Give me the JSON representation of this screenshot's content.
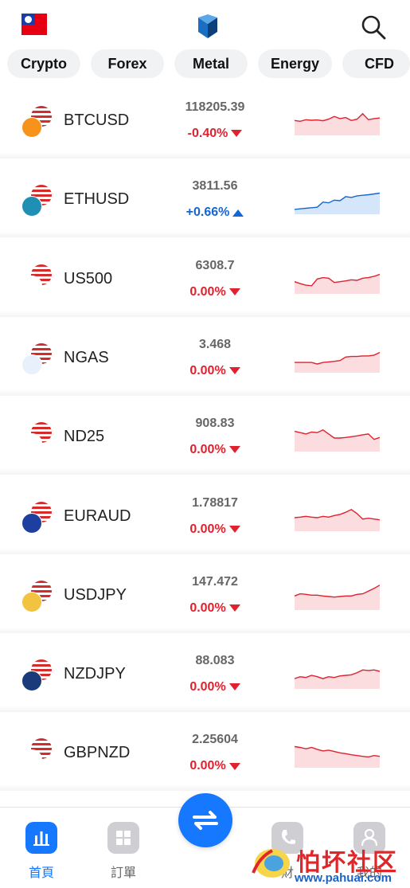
{
  "header": {
    "flag_icon": "taiwan-flag-icon",
    "logo_icon": "app-logo-icon",
    "search_icon": "search-icon"
  },
  "tabs": [
    {
      "label": "Crypto"
    },
    {
      "label": "Forex"
    },
    {
      "label": "Metal"
    },
    {
      "label": "Energy"
    },
    {
      "label": "CFD"
    }
  ],
  "colors": {
    "down": "#e0212e",
    "up": "#1466d8",
    "accent": "#1677ff"
  },
  "quotes": [
    {
      "symbol": "BTCUSD",
      "price": "118205.39",
      "change": "-0.40%",
      "direction": "down",
      "icon": "btc-usd-icon",
      "spark": [
        0.45,
        0.48,
        0.42,
        0.44,
        0.43,
        0.46,
        0.4,
        0.3,
        0.38,
        0.34,
        0.45,
        0.4,
        0.2,
        0.42,
        0.38,
        0.36
      ]
    },
    {
      "symbol": "ETHUSD",
      "price": "3811.56",
      "change": "+0.66%",
      "direction": "up",
      "icon": "eth-usd-icon",
      "spark": [
        0.82,
        0.8,
        0.78,
        0.76,
        0.74,
        0.55,
        0.58,
        0.48,
        0.5,
        0.35,
        0.38,
        0.32,
        0.3,
        0.28,
        0.25,
        0.22
      ]
    },
    {
      "symbol": "US500",
      "price": "6308.7",
      "change": "0.00%",
      "direction": "down",
      "icon": "us500-icon",
      "spark": [
        0.55,
        0.62,
        0.68,
        0.7,
        0.45,
        0.4,
        0.42,
        0.58,
        0.55,
        0.52,
        0.48,
        0.5,
        0.42,
        0.4,
        0.35,
        0.28
      ]
    },
    {
      "symbol": "NGAS",
      "price": "3.468",
      "change": "0.00%",
      "direction": "down",
      "icon": "natural-gas-icon",
      "spark": [
        0.62,
        0.62,
        0.62,
        0.62,
        0.68,
        0.62,
        0.6,
        0.58,
        0.55,
        0.42,
        0.4,
        0.4,
        0.38,
        0.38,
        0.35,
        0.25
      ]
    },
    {
      "symbol": "ND25",
      "price": "908.83",
      "change": "0.00%",
      "direction": "down",
      "icon": "nd25-icon",
      "spark": [
        0.25,
        0.3,
        0.35,
        0.28,
        0.3,
        0.2,
        0.35,
        0.5,
        0.5,
        0.48,
        0.45,
        0.42,
        0.38,
        0.35,
        0.55,
        0.48
      ]
    },
    {
      "symbol": "EURAUD",
      "price": "1.78817",
      "change": "0.00%",
      "direction": "down",
      "icon": "eur-aud-icon",
      "spark": [
        0.5,
        0.48,
        0.45,
        0.48,
        0.5,
        0.45,
        0.48,
        0.42,
        0.38,
        0.3,
        0.2,
        0.35,
        0.55,
        0.52,
        0.55,
        0.58
      ]
    },
    {
      "symbol": "USDJPY",
      "price": "147.472",
      "change": "0.00%",
      "direction": "down",
      "icon": "usd-jpy-icon",
      "spark": [
        0.48,
        0.4,
        0.42,
        0.45,
        0.45,
        0.48,
        0.5,
        0.52,
        0.5,
        0.48,
        0.48,
        0.42,
        0.4,
        0.3,
        0.2,
        0.08
      ]
    },
    {
      "symbol": "NZDJPY",
      "price": "88.083",
      "change": "0.00%",
      "direction": "down",
      "icon": "nzd-jpy-icon",
      "spark": [
        0.62,
        0.55,
        0.58,
        0.5,
        0.55,
        0.62,
        0.55,
        0.58,
        0.52,
        0.5,
        0.48,
        0.4,
        0.3,
        0.32,
        0.3,
        0.35
      ]
    },
    {
      "symbol": "GBPNZD",
      "price": "2.25604",
      "change": "0.00%",
      "direction": "down",
      "icon": "gbp-nzd-icon",
      "spark": [
        0.22,
        0.25,
        0.3,
        0.25,
        0.32,
        0.38,
        0.35,
        0.4,
        0.45,
        0.48,
        0.52,
        0.55,
        0.58,
        0.6,
        0.55,
        0.58
      ]
    }
  ],
  "bottom_nav": [
    {
      "label": "首頁",
      "icon": "chart-bar-icon",
      "active": true
    },
    {
      "label": "訂單",
      "icon": "grid-icon",
      "active": false
    },
    {
      "label": "",
      "icon": "swap-arrows-icon",
      "active": false
    },
    {
      "label": "財",
      "icon": "phone-icon",
      "active": false
    },
    {
      "label": "我的",
      "icon": "user-icon",
      "active": false
    }
  ],
  "watermark": {
    "text": "怕坏社区",
    "url": "www.pahuai.com"
  }
}
